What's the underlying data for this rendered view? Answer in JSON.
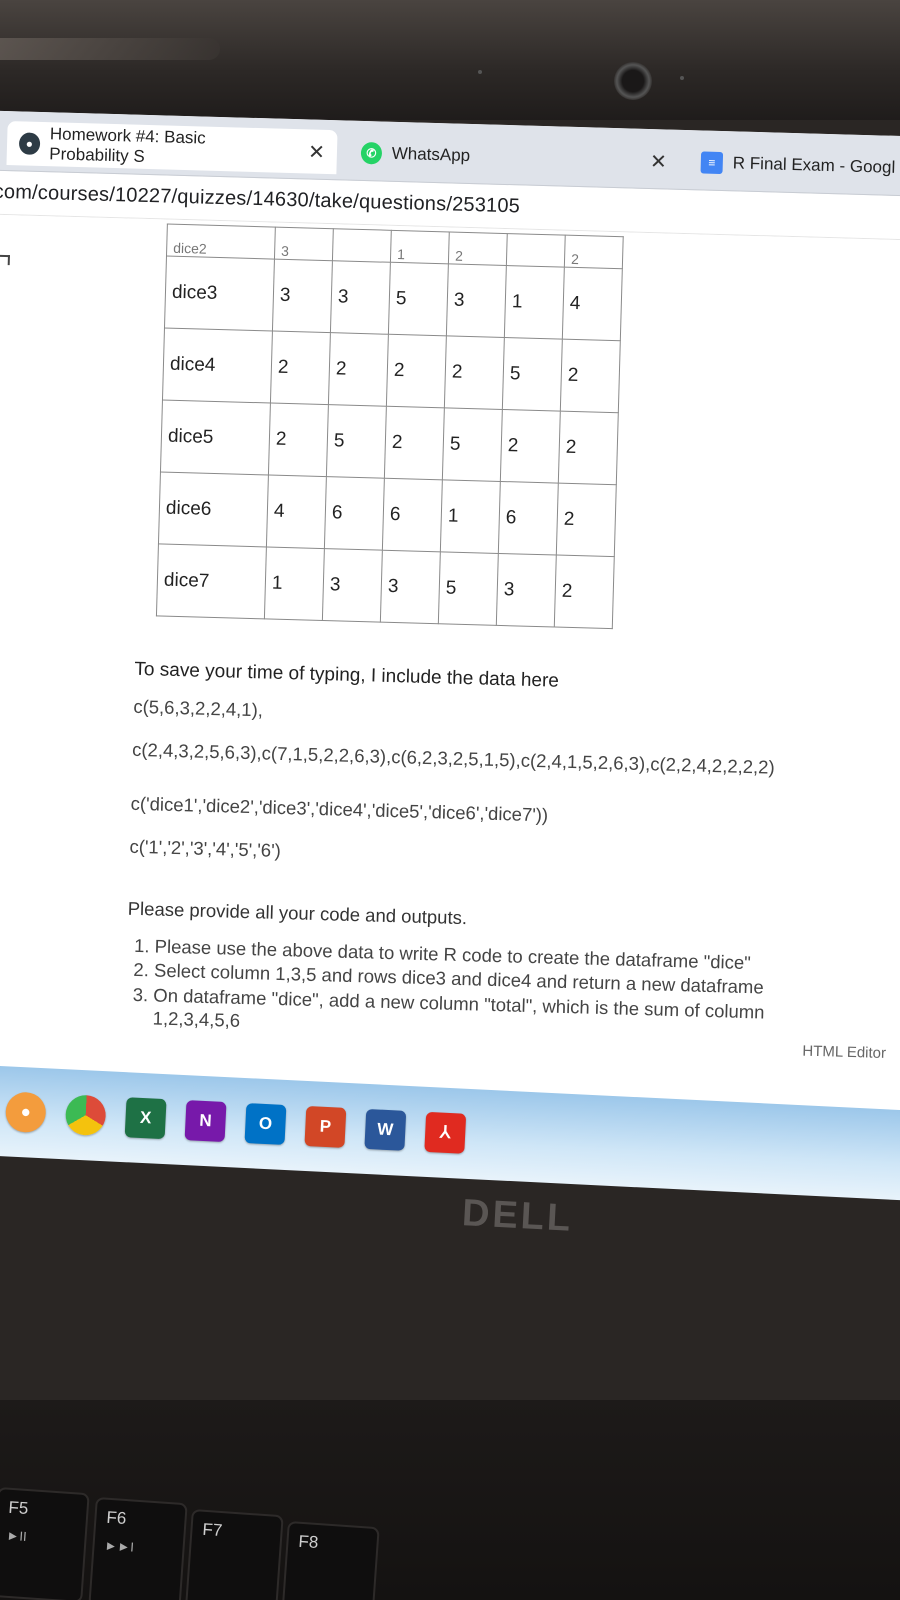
{
  "browser": {
    "tabs": [
      {
        "label": "Homework #4: Basic Probability S",
        "icon": "canvas-icon",
        "close": "✕"
      },
      {
        "label": "WhatsApp",
        "icon": "whatsapp-icon",
        "close": "✕"
      },
      {
        "label": "R Final Exam - Googl",
        "icon": "google-forms-icon"
      }
    ],
    "url": "com/courses/10227/quizzes/14630/take/questions/253105"
  },
  "table": {
    "partial_row": {
      "name": "dice2",
      "values": [
        "3",
        "",
        "1",
        "2",
        "",
        "2"
      ]
    },
    "rows": [
      {
        "name": "dice3",
        "values": [
          "3",
          "3",
          "5",
          "3",
          "1",
          "4"
        ]
      },
      {
        "name": "dice4",
        "values": [
          "2",
          "2",
          "2",
          "2",
          "5",
          "2"
        ]
      },
      {
        "name": "dice5",
        "values": [
          "2",
          "5",
          "2",
          "5",
          "2",
          "2"
        ]
      },
      {
        "name": "dice6",
        "values": [
          "4",
          "6",
          "6",
          "1",
          "6",
          "2"
        ]
      },
      {
        "name": "dice7",
        "values": [
          "1",
          "3",
          "3",
          "5",
          "3",
          "2"
        ]
      }
    ]
  },
  "question": {
    "intro": "To save your time of typing, I include the data here",
    "code_line1": "c(5,6,3,2,2,4,1),",
    "code_line2": "c(2,4,3,2,5,6,3),c(7,1,5,2,2,6,3),c(6,2,3,2,5,1,5),c(2,4,1,5,2,6,3),c(2,2,4,2,2,2,2)",
    "code_line3": "c('dice1','dice2','dice3','dice4','dice5','dice6','dice7'))",
    "code_line4": "c('1','2','3','4','5','6')",
    "instruction": "Please provide all your code and outputs.",
    "items": [
      "Please use the above data to write R code to create the dataframe \"dice\"",
      "Select column 1,3,5 and rows dice3 and dice4 and return a new dataframe",
      "On dataframe \"dice\", add a new column \"total\", which is the sum of column"
    ],
    "item3_cont": "1,2,3,4,5,6",
    "html_editor": "HTML Editor"
  },
  "taskbar": {
    "apps": [
      {
        "name": "app-icon",
        "letter": "",
        "color": "#f39c3d"
      },
      {
        "name": "chrome-icon",
        "letter": "",
        "color": "#dd4b39"
      },
      {
        "name": "excel-icon",
        "letter": "X",
        "color": "#1e7145"
      },
      {
        "name": "onenote-icon",
        "letter": "N",
        "color": "#7719aa"
      },
      {
        "name": "outlook-icon",
        "letter": "O",
        "color": "#0072c6"
      },
      {
        "name": "powerpoint-icon",
        "letter": "P",
        "color": "#d24726"
      },
      {
        "name": "word-icon",
        "letter": "W",
        "color": "#2b579a"
      },
      {
        "name": "acrobat-icon",
        "letter": "⅄",
        "color": "#e02a20"
      }
    ]
  },
  "hardware": {
    "brand": "DELL",
    "fkeys": [
      {
        "label": "F5",
        "sub": "►II"
      },
      {
        "label": "F6",
        "sub": "►►I"
      },
      {
        "label": "F7",
        "sub": ""
      },
      {
        "label": "F8",
        "sub": ""
      }
    ]
  }
}
